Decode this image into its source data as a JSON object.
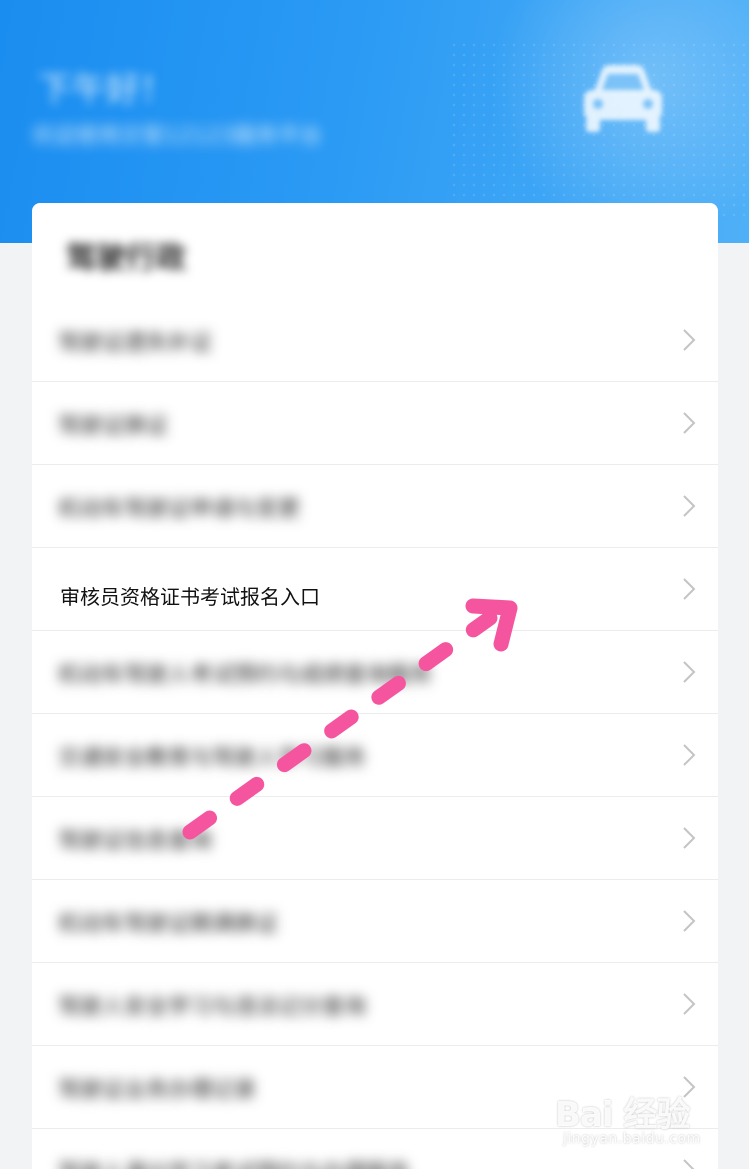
{
  "header": {
    "greeting": "下午好！",
    "subtitle": "欢迎使用交管12123服务平台"
  },
  "card": {
    "title": "驾驶行政",
    "items": [
      {
        "label": "驾驶证遗失补证",
        "highlighted": false
      },
      {
        "label": "驾驶证换证",
        "highlighted": false
      },
      {
        "label": "机动车驾驶证申请与变更",
        "highlighted": false
      },
      {
        "label": "审核员资格证书考试报名入口",
        "highlighted": true
      },
      {
        "label": "机动车驾驶人考试预约与成绩查询服务",
        "highlighted": false
      },
      {
        "label": "交通安全教育与驾驶人学习服务",
        "highlighted": false
      },
      {
        "label": "驾驶证信息查询",
        "highlighted": false
      },
      {
        "label": "机动车驾驶证期满换证",
        "highlighted": false
      },
      {
        "label": "驾驶人安全学习与违法记分查询",
        "highlighted": false
      },
      {
        "label": "驾驶证业务办理记录",
        "highlighted": false
      },
      {
        "label": "驾驶人满分学习考试预约与办理服务",
        "highlighted": false
      }
    ]
  },
  "annotation": {
    "arrow_color": "#f5559f"
  },
  "watermark": {
    "brand": "Bai 经验",
    "site": "jingyan.baidu.com"
  },
  "icons": {
    "header_icon": "car-icon",
    "row_icon": "chevron-right-icon",
    "watermark_icon": "paw-icon"
  },
  "colors": {
    "header_blue": "#1a8df0",
    "page_bg": "#f2f3f5",
    "chevron": "#c4c4c4"
  }
}
